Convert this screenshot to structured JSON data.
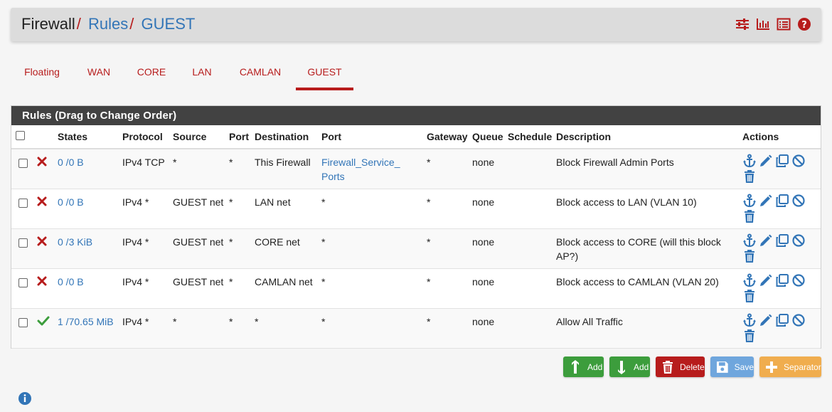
{
  "breadcrumb": {
    "root": "Firewall",
    "sep": "/",
    "rules": "Rules",
    "current": "GUEST"
  },
  "header_icons": [
    "sliders-icon",
    "bar-chart-icon",
    "list-icon",
    "help-icon"
  ],
  "tabs": [
    {
      "label": "Floating"
    },
    {
      "label": "WAN"
    },
    {
      "label": "CORE"
    },
    {
      "label": "LAN"
    },
    {
      "label": "CAMLAN"
    },
    {
      "label": "GUEST",
      "active": true
    }
  ],
  "panel": {
    "title": "Rules (Drag to Change Order)",
    "columns": {
      "states": "States",
      "protocol": "Protocol",
      "source": "Source",
      "port": "Port",
      "destination": "Destination",
      "dport": "Port",
      "gateway": "Gateway",
      "queue": "Queue",
      "schedule": "Schedule",
      "description": "Description",
      "actions": "Actions"
    },
    "rows": [
      {
        "status": "block",
        "states": "0 /0 B",
        "protocol": "IPv4 TCP",
        "source": "*",
        "sport": "*",
        "destination": "This Firewall",
        "dport": "Firewall_Service_ Ports",
        "dport_link": true,
        "gateway": "*",
        "queue": "none",
        "schedule": "",
        "description": "Block Firewall Admin Ports"
      },
      {
        "status": "block",
        "states": "0 /0 B",
        "protocol": "IPv4 *",
        "source": "GUEST net",
        "sport": "*",
        "destination": "LAN net",
        "dport": "*",
        "dport_link": false,
        "gateway": "*",
        "queue": "none",
        "schedule": "",
        "description": "Block access to LAN (VLAN 10)"
      },
      {
        "status": "block",
        "states": "0 /3 KiB",
        "protocol": "IPv4 *",
        "source": "GUEST net",
        "sport": "*",
        "destination": "CORE net",
        "dport": "*",
        "dport_link": false,
        "gateway": "*",
        "queue": "none",
        "schedule": "",
        "description": "Block access to CORE (will this block AP?)"
      },
      {
        "status": "block",
        "states": "0 /0 B",
        "protocol": "IPv4 *",
        "source": "GUEST net",
        "sport": "*",
        "destination": "CAMLAN net",
        "dport": "*",
        "dport_link": false,
        "gateway": "*",
        "queue": "none",
        "schedule": "",
        "description": "Block access to CAMLAN (VLAN 20)"
      },
      {
        "status": "pass",
        "states": "1 /70.65 MiB",
        "protocol": "IPv4 *",
        "source": "*",
        "sport": "*",
        "destination": "*",
        "dport": "*",
        "dport_link": false,
        "gateway": "*",
        "queue": "none",
        "schedule": "",
        "description": "Allow All Traffic"
      }
    ]
  },
  "buttons": {
    "add_top": "Add",
    "add_bottom": "Add",
    "delete": "Delete",
    "save": "Save",
    "separator": "Separator"
  },
  "colors": {
    "accent_red": "#b71c1c",
    "link_blue": "#3275b7",
    "success": "#3c9d3c",
    "delete": "#b71c1c",
    "save": "#6fa6dd",
    "separator": "#f0ad4e",
    "panel_heading": "#424242"
  }
}
